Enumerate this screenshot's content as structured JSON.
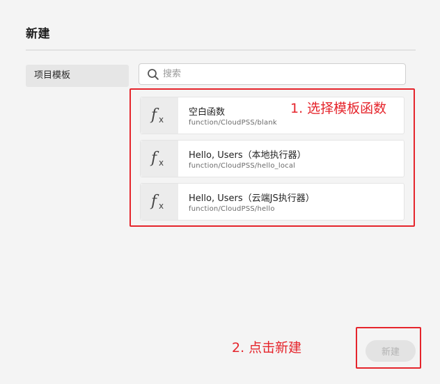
{
  "page": {
    "title": "新建"
  },
  "sidebar": {
    "items": [
      {
        "label": "项目模板"
      }
    ]
  },
  "search": {
    "placeholder": "搜索",
    "value": "",
    "icon": "search-icon"
  },
  "templates": [
    {
      "icon": "function-icon",
      "name": "空白函数",
      "path": "function/CloudPSS/blank"
    },
    {
      "icon": "function-icon",
      "name": "Hello, Users（本地执行器）",
      "path": "function/CloudPSS/hello_local"
    },
    {
      "icon": "function-icon",
      "name": "Hello, Users（云端JS执行器）",
      "path": "function/CloudPSS/hello"
    }
  ],
  "annotations": {
    "step1": "1. 选择模板函数",
    "step2": "2. 点击新建",
    "color": "#e5242b"
  },
  "footer": {
    "create_label": "新建",
    "create_disabled": true
  }
}
